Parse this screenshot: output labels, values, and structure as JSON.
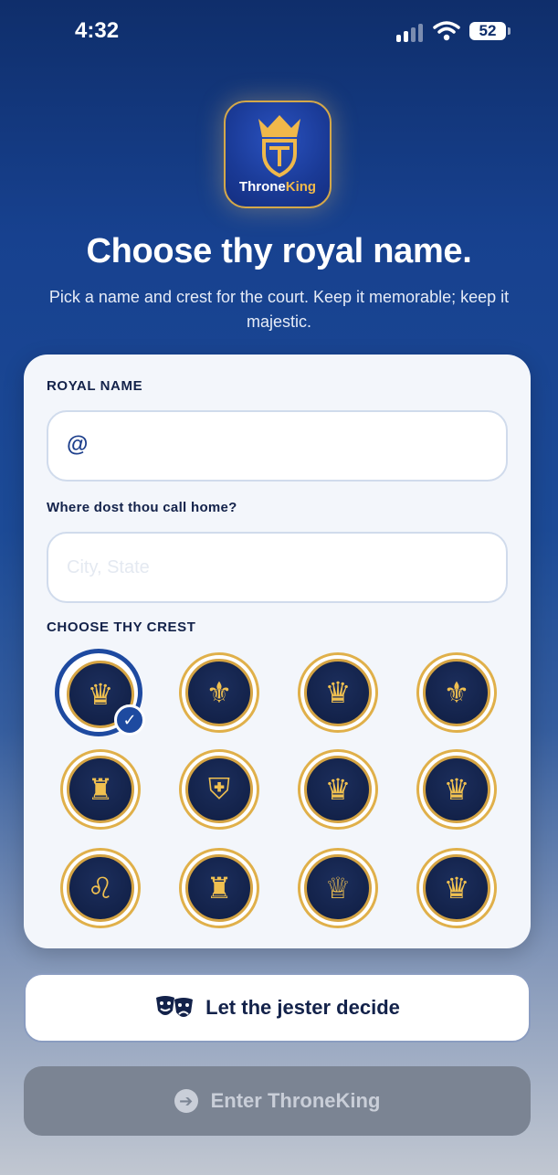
{
  "status_bar": {
    "time": "4:32",
    "battery": "52"
  },
  "app": {
    "name_part1": "Throne",
    "name_part2": "King"
  },
  "header": {
    "title": "Choose thy royal name.",
    "subtitle": "Pick a name and crest for the court. Keep it memorable; keep it majestic."
  },
  "form": {
    "royal_name_label": "ROYAL NAME",
    "royal_name_prefix": "@",
    "royal_name_value": "",
    "home_label": "Where dost thou call home?",
    "home_placeholder": "City, State",
    "crest_label": "CHOOSE THY CREST",
    "crests": [
      {
        "icon": "crown-toilet-icon",
        "glyph": "♛",
        "selected": true
      },
      {
        "icon": "crossed-plungers-icon",
        "glyph": "⚜"
      },
      {
        "icon": "toilet-paper-laurel-icon",
        "glyph": "♛"
      },
      {
        "icon": "fountain-fleur-icon",
        "glyph": "⚜"
      },
      {
        "icon": "throne-chair-icon",
        "glyph": "♜"
      },
      {
        "icon": "water-drop-shield-icon",
        "glyph": "⛨"
      },
      {
        "icon": "key-paper-roll-icon",
        "glyph": "♛"
      },
      {
        "icon": "bidet-sprayer-icon",
        "glyph": "♛"
      },
      {
        "icon": "lion-rampant-icon",
        "glyph": "♌"
      },
      {
        "icon": "castle-tower-icon",
        "glyph": "♜"
      },
      {
        "icon": "toilet-laurel-icon",
        "glyph": "♕"
      },
      {
        "icon": "jester-hat-icon",
        "glyph": "♛"
      }
    ]
  },
  "actions": {
    "jester_label": "Let the jester decide",
    "enter_label": "Enter ThroneKing"
  }
}
